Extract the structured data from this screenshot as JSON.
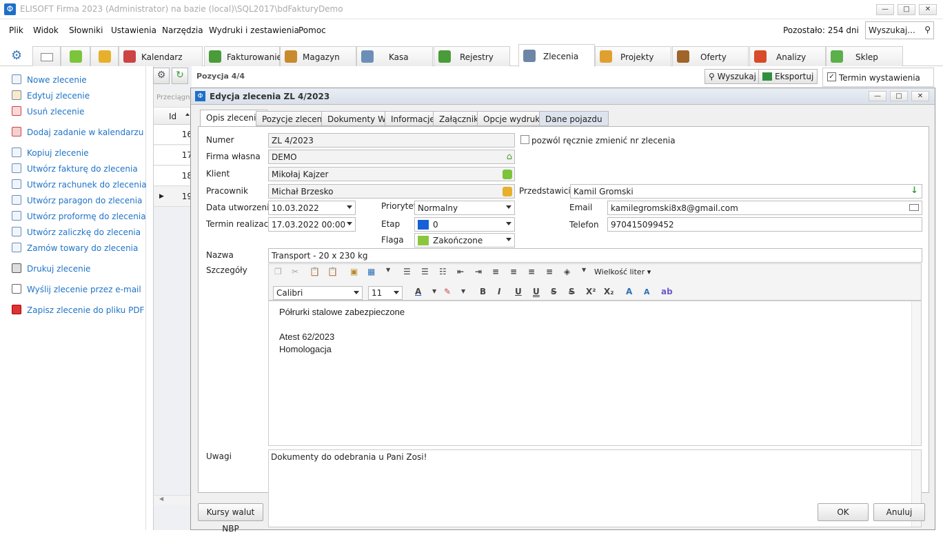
{
  "window": {
    "title": "ELISOFT Firma 2023 (Administrator) na bazie (local)\\SQL2017\\bdFakturyDemo",
    "logo": "Φ"
  },
  "menu": [
    "Plik",
    "Widok",
    "Słowniki",
    "Ustawienia",
    "Narzędzia",
    "Wydruki i zestawienia",
    "Pomoc"
  ],
  "remaining": "Pozostało: 254 dni",
  "topsearch": "Wyszukaj...",
  "tabs": [
    "Kalendarz",
    "Fakturowanie",
    "Magazyn",
    "Kasa",
    "Rejestry",
    "Zlecenia",
    "Projekty",
    "Oferty",
    "Analizy",
    "Sklep"
  ],
  "sidebar": [
    "Nowe zlecenie",
    "Edytuj zlecenie",
    "Usuń zlecenie",
    "Dodaj zadanie w kalendarzu",
    "Kopiuj zlecenie",
    "Utwórz fakturę do zlecenia",
    "Utwórz rachunek do zlecenia",
    "Utwórz paragon do zlecenia",
    "Utwórz proformę do zlecenia",
    "Utwórz zaliczkę do zlecenia",
    "Zamów towary do zlecenia",
    "Drukuj zlecenie",
    "Wyślij zlecenie przez e-mail",
    "Zapisz zlecenie do pliku PDF"
  ],
  "toolbar": {
    "position": "Pozycja 4/4",
    "search": "Wyszukaj",
    "export": "Eksportuj",
    "termin": "Termin wystawienia"
  },
  "grid": {
    "drag_hint": "Przeciągnij",
    "col_id": "Id",
    "rows": [
      "16",
      "17",
      "18",
      "19"
    ]
  },
  "dialog": {
    "title": "Edycja zlecenia ZL 4/2023",
    "tabs": [
      "Opis zlecenia",
      "Pozycje zlecenia",
      "Dokumenty WZ",
      "Informacje",
      "Załączniki",
      "Opcje wydruku",
      "Dane pojazdu"
    ],
    "labels": {
      "numer": "Numer",
      "firma": "Firma własna",
      "klient": "Klient",
      "pracownik": "Pracownik",
      "przedstawiciel": "Przedstawiciel",
      "data_utw": "Data utworzenia",
      "termin_real": "Termin realizacji",
      "priorytet": "Priorytet",
      "etap": "Etap",
      "flaga": "Flaga",
      "email": "Email",
      "telefon": "Telefon",
      "nazwa": "Nazwa",
      "szczegoly": "Szczegóły",
      "uwagi": "Uwagi"
    },
    "values": {
      "numer": "ZL 4/2023",
      "manual_change": "pozwól ręcznie zmienić nr zlecenia",
      "firma": "DEMO",
      "klient": "Mikołaj Kajzer",
      "pracownik": "Michał Brzesko",
      "przedstawiciel": "Kamil Gromski",
      "data_utw": "10.03.2022",
      "termin_real": "17.03.2022 00:00",
      "priorytet": "Normalny",
      "etap": "0",
      "flaga": "Zakończone",
      "email": "kamilegromski8x8@gmail.com",
      "telefon": "970415099452",
      "nazwa": "Transport - 20 x 230 kg"
    },
    "editor": {
      "font": "Calibri",
      "size": "11",
      "font_size_menu": "Wielkość liter",
      "lines": [
        "Półrurki stalowe zabezpieczone",
        "",
        "Atest 62/2023",
        "Homologacja"
      ]
    },
    "uwagi": "Dokumenty do odebrania u Pani Zosi!",
    "buttons": {
      "kursy": "Kursy walut NBP",
      "ok": "OK",
      "cancel": "Anuluj"
    },
    "colors": {
      "etap": "#1560d8",
      "flaga": "#8cc63f"
    }
  }
}
